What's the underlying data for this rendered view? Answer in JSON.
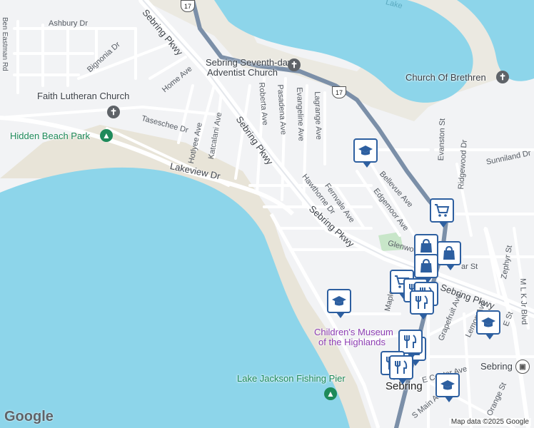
{
  "roads": {
    "ashbury": "Ashbury Dr",
    "ben_eastman": "Ben Eastman Rd",
    "bignonia": "Bignonia Dr",
    "home": "Home Ave",
    "tasseschee": "Taseschee Dr",
    "hotlyee": "Hotlyee Ave",
    "katcalani": "Katcalani Ave",
    "lakeview": "Lakeview Dr",
    "sebring_pkwy_top": "Sebring Pkwy",
    "sebring_pkwy_mid": "Sebring Pkwy",
    "sebring_pkwy_low": "Sebring Pkwy",
    "sebring_pkwy_right": "Sebring Pkwy",
    "roberta": "Roberta Ave",
    "pasadena": "Pasadena Ave",
    "evangeline": "Evangeline Ave",
    "lagrange": "Lagrange Ave",
    "hawthorne": "Hawthorne Dr",
    "fernvale": "Fernvale Ave",
    "bellevue": "Bellevue Ave",
    "edgemoor": "Edgemoor Ave",
    "glenwood": "Glenwood",
    "evanston": "Evanston St",
    "ridgewood": "Ridgewood Dr",
    "sunniland": "Sunniland Dr",
    "zephyr": "Zephyr St",
    "mlk": "M L K Jr Blvd",
    "grapefruit": "Grapefruit Ave",
    "lemon": "Lemon Ave",
    "maple": "Maple",
    "center": "E Center Ave",
    "s_main": "S Main Ave",
    "e_st": "E St",
    "ar_st": "ar St",
    "orange": "Orange St"
  },
  "route": "17",
  "places": {
    "adventist": "Sebring Seventh-day Adventist Church",
    "adventist_l1": "Sebring Seventh-day",
    "adventist_l2": "Adventist Church",
    "lutheran": "Faith Lutheran Church",
    "brethren": "Church Of Brethren",
    "hidden_beach": "Hidden Beach Park",
    "museum_l1": "Children's Museum",
    "museum_l2": "of the Highlands",
    "pier": "Lake Jackson Fishing Pier",
    "sebring": "Sebring",
    "sebring_station": "Sebring",
    "lake": "Lake"
  },
  "icons": {
    "church": "church-icon",
    "park": "park-icon",
    "school": "school-icon",
    "shopping_cart": "shopping-cart-icon",
    "shopping_bag": "shopping-bag-icon",
    "restaurant": "restaurant-icon",
    "train": "train-icon"
  },
  "colors": {
    "water": "#8dd5ea",
    "land": "#f2f3f5",
    "sand": "#e8e4d8",
    "highway": "#7b8fa8",
    "poi_blue": "#2d5fa0",
    "park_green": "#1e8a5a",
    "museum_purple": "#8e3fb4"
  },
  "branding": {
    "logo": "Google",
    "attribution": "Map data ©2025 Google"
  }
}
